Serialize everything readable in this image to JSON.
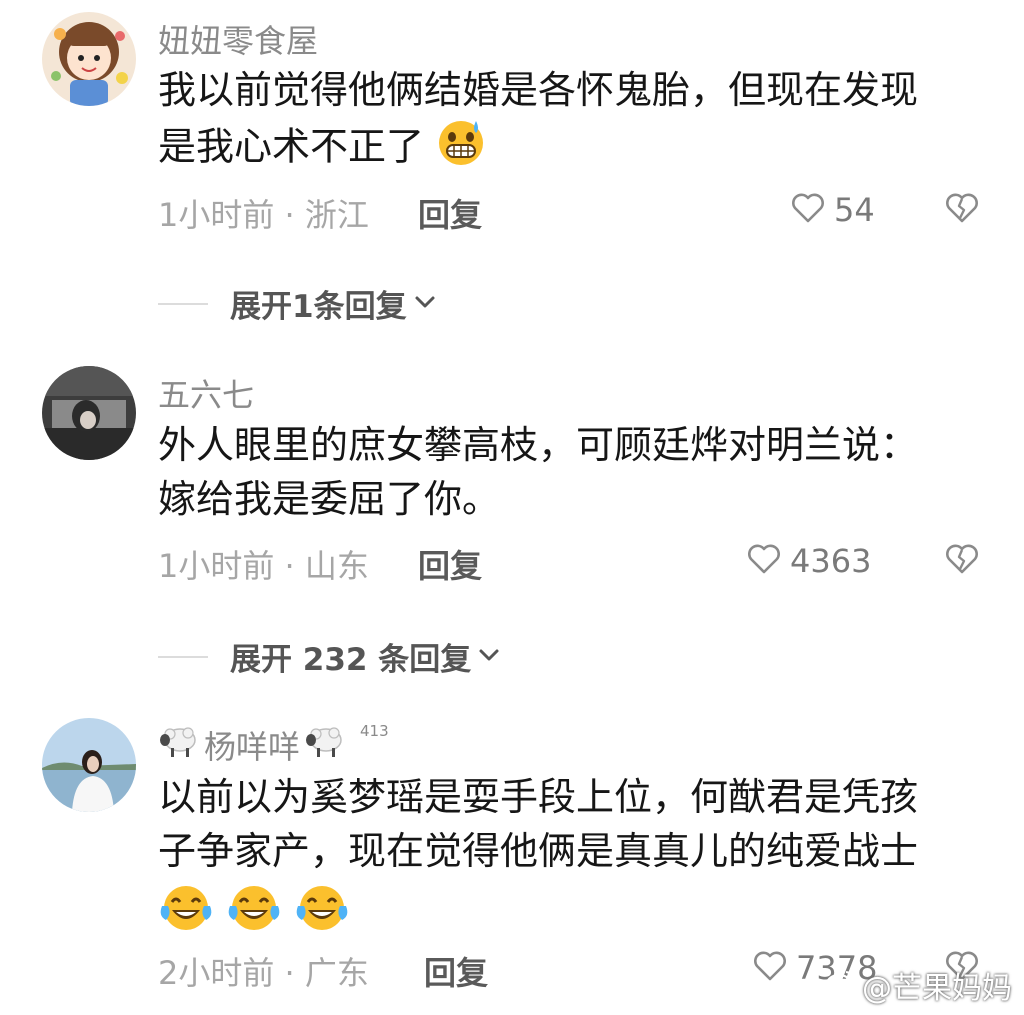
{
  "comments": [
    {
      "username": "妞妞零食屋",
      "content_line1": "我以前觉得他俩结婚是各怀鬼胎，但现在发现",
      "content_line2": "是我心术不正了",
      "time_location": "1小时前 · 浙江",
      "reply_label": "回复",
      "likes": "54",
      "expand_text": "展开1条回复",
      "emoji": "grin-sweat"
    },
    {
      "username": "五六七",
      "content_line1": "外人眼里的庶女攀高枝，可顾廷烨对明兰说：",
      "content_line2": "嫁给我是委屈了你。",
      "time_location": "1小时前 · 山东",
      "reply_label": "回复",
      "likes": "4363",
      "expand_text": "展开 232 条回复"
    },
    {
      "username": "杨咩咩",
      "level": "413",
      "content_line1": "以前以为奚梦瑶是耍手段上位，何猷君是凭孩",
      "content_line2": "子争家产，现在觉得他俩是真真儿的纯爱战士",
      "time_location": "2小时前 · 广东",
      "reply_label": "回复",
      "likes": "7378",
      "emoji": "tears-of-joy"
    }
  ],
  "icons": {
    "like": "heart-outline-icon",
    "dislike": "broken-heart-icon",
    "expand": "chevron-down-icon",
    "sheep": "sheep-emoji-icon"
  },
  "watermark": {
    "text": "@芒果妈妈"
  }
}
